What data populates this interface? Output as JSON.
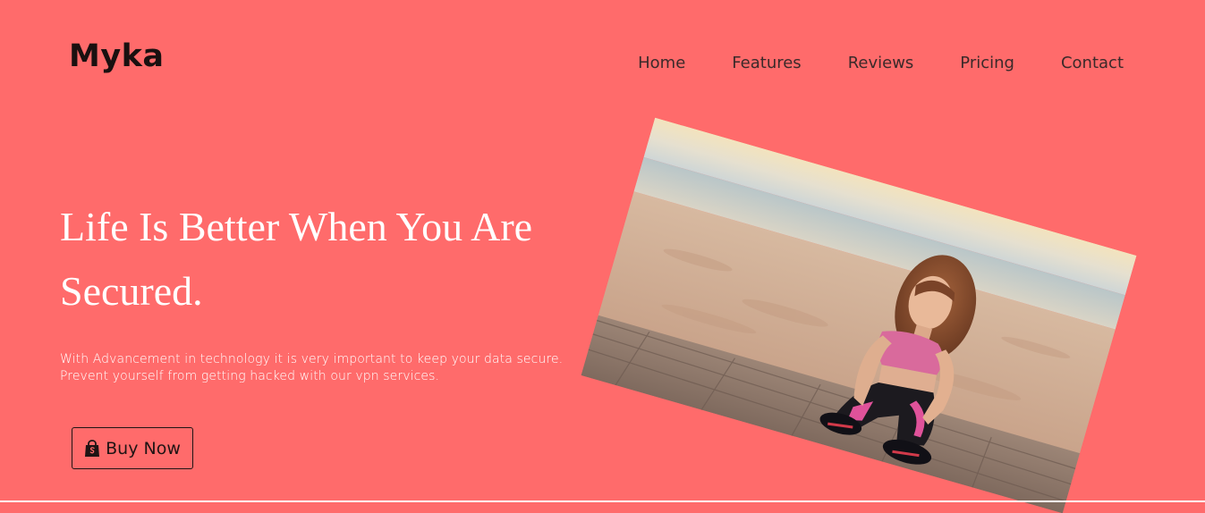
{
  "brand": {
    "name": "Myka"
  },
  "nav": {
    "items": [
      {
        "id": "home",
        "label": "Home"
      },
      {
        "id": "features",
        "label": "Features"
      },
      {
        "id": "reviews",
        "label": "Reviews"
      },
      {
        "id": "pricing",
        "label": "Pricing"
      },
      {
        "id": "contact",
        "label": "Contact"
      }
    ]
  },
  "hero": {
    "title": "Life Is Better When You Are Secured.",
    "description": "With Advancement in technology it is very important to keep your data secure. Prevent yourself from getting hacked with our vpn services.",
    "cta_label": "Buy Now",
    "cta_icon": "shopping-bag-icon",
    "image_alt": "woman tying shoes on beach"
  },
  "colors": {
    "background": "#ff6b6b",
    "text_dark": "#1a1010",
    "text_light": "#ffffff"
  }
}
